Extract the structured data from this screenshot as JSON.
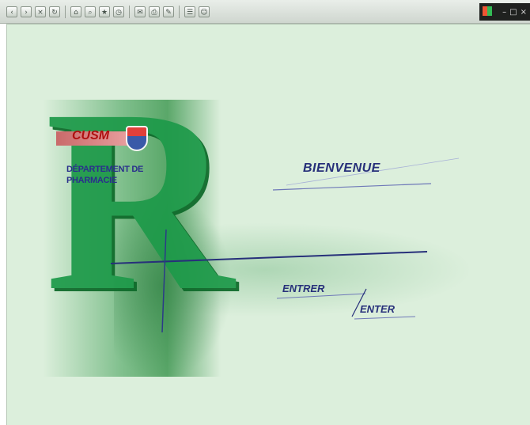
{
  "toolbar": {
    "buttons": [
      {
        "name": "back-button",
        "icon": "‹"
      },
      {
        "name": "forward-button",
        "icon": "›"
      },
      {
        "name": "stop-button",
        "icon": "×"
      },
      {
        "name": "refresh-button",
        "icon": "↻"
      },
      {
        "name": "home-button",
        "icon": "⌂"
      },
      {
        "name": "search-button",
        "icon": "⌕"
      },
      {
        "name": "favorites-button",
        "icon": "★"
      },
      {
        "name": "history-button",
        "icon": "◷"
      },
      {
        "name": "mail-button",
        "icon": "✉"
      },
      {
        "name": "print-button",
        "icon": "⎙"
      },
      {
        "name": "edit-button",
        "icon": "✎"
      },
      {
        "name": "discuss-button",
        "icon": "☰"
      },
      {
        "name": "messenger-button",
        "icon": "☺"
      }
    ]
  },
  "page": {
    "logo_text": "CUSM",
    "department": [
      "DÉPARTEMENT DE",
      "PHARMACIE"
    ],
    "welcome": "BIENVENUE",
    "enter_fr": "ENTRER",
    "enter_en": "ENTER"
  },
  "colors": {
    "background": "#dcefdc",
    "accent_green": "#1e9a4a",
    "navy_text": "#27307a"
  }
}
